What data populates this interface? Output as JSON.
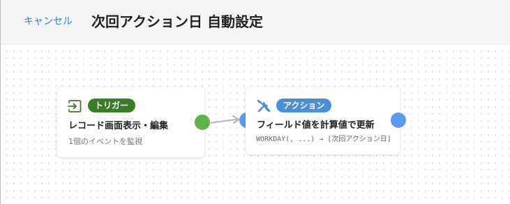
{
  "header": {
    "cancel_label": "キャンセル",
    "title": "次回アクション日 自動設定"
  },
  "trigger_node": {
    "badge": "トリガー",
    "icon": "import-arrow-icon",
    "title": "レコード画面表示・編集",
    "subtitle": "1個のイベントを監視",
    "icon_color": "#3a7d28",
    "badge_color": "#3a7d28",
    "port_color": "#5cb34a"
  },
  "action_node": {
    "badge": "アクション",
    "icon": "tools-icon",
    "title": "フィールド値を計算値で更新",
    "formula": "WORKDAY(, ...) → [次回アクション日]",
    "icon_color": "#4b8fd8",
    "badge_color": "#4b8fd8",
    "port_color": "#5b9cf0"
  },
  "colors": {
    "accent": "#3b7fd1",
    "connector": "#b5b5b5"
  }
}
